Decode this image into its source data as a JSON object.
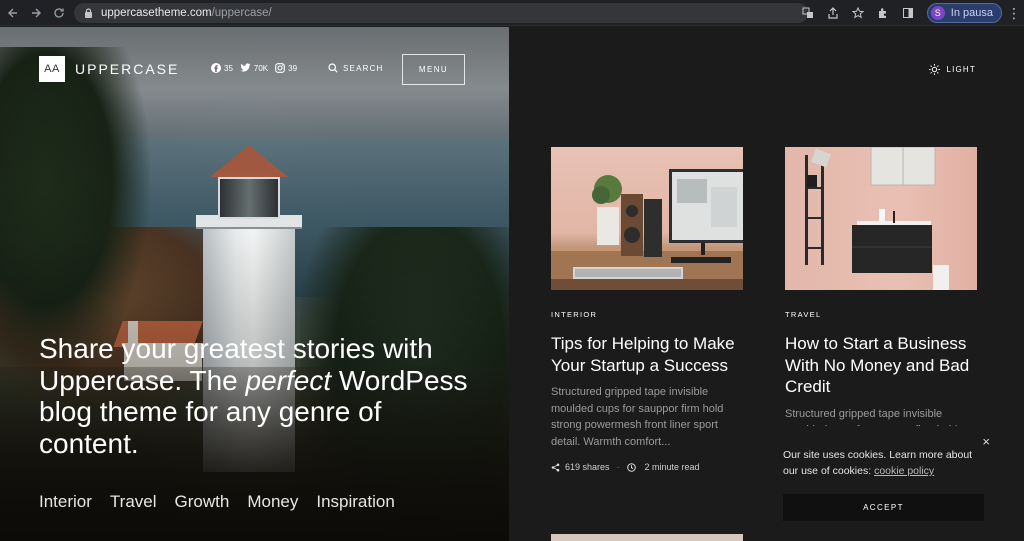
{
  "browser": {
    "url_host": "uppercasetheme.com",
    "url_path": "/uppercase/",
    "profile_initial": "S",
    "profile_label": "In pausa"
  },
  "site": {
    "logo_mark": "AA",
    "logo_text": "UPPERCASE",
    "socials": [
      {
        "icon": "facebook-icon",
        "count": "35"
      },
      {
        "icon": "twitter-icon",
        "count": "70K"
      },
      {
        "icon": "instagram-icon",
        "count": "39"
      }
    ],
    "search_label": "SEARCH",
    "menu_label": "MENU",
    "theme_toggle_label": "LIGHT"
  },
  "hero": {
    "headline_before": "Share your greatest stories with Uppercase. The ",
    "headline_em": "perfect",
    "headline_after": " WordPess blog theme for any genre of content.",
    "categories": [
      "Interior",
      "Travel",
      "Growth",
      "Money",
      "Inspiration"
    ]
  },
  "posts": [
    {
      "category": "INTERIOR",
      "title": "Tips for Helping to Make Your Startup a Success",
      "excerpt": "Structured gripped tape invisible moulded cups for sauppor firm hold strong powermesh front liner sport detail. Warmth comfort...",
      "shares": "619 shares",
      "read_time": "2 minute read"
    },
    {
      "category": "TRAVEL",
      "title": "How to Start a Business With No Money and Bad Credit",
      "excerpt": "Structured gripped tape invisible moulded cups for sauppor firm hold"
    }
  ],
  "cookie": {
    "text": "Our site uses cookies. Learn more about our use of cookies: ",
    "link": "cookie policy",
    "accept": "ACCEPT",
    "close": "×"
  },
  "colors": {
    "page_bg": "#1b1b1b",
    "chrome_bg": "#202124"
  }
}
